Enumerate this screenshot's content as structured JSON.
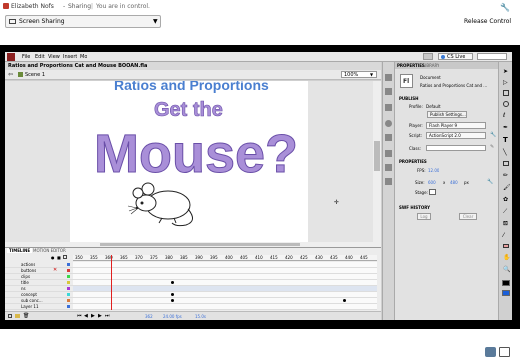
{
  "share_header": {
    "presenter": "Elizabeth Nofs",
    "app": "Sharing",
    "status": "You are in control.",
    "mode": "Screen Sharing",
    "release": "Release Control"
  },
  "menu": {
    "items": [
      "File",
      "Edit",
      "View",
      "Insert",
      "Mo"
    ],
    "cs_live": "CS Live"
  },
  "document": {
    "tab_title": "Ratios and Proportions Cat and Mouse BOOAN.fla",
    "scene": "Scene 1",
    "zoom": "100%"
  },
  "stage": {
    "title": "Ratios and Proportions",
    "get_the": "Get the",
    "mouse": "Mouse?"
  },
  "timeline": {
    "tabs": [
      "TIMELINE",
      "MOTION EDITOR"
    ],
    "frames": [
      "350",
      "355",
      "360",
      "365",
      "370",
      "375",
      "380",
      "385",
      "390",
      "395",
      "400",
      "405",
      "410",
      "415",
      "420",
      "425",
      "430",
      "435",
      "440",
      "445"
    ],
    "layers": [
      "actions",
      "buttons",
      "clips",
      "title",
      "ns",
      "concept",
      "sub conc...",
      "Layer 11"
    ],
    "footer_values": [
      "362",
      "24.00 fps",
      "15.0s"
    ]
  },
  "properties": {
    "tabs": [
      "PROPERTIES",
      "LIBRARY"
    ],
    "doc_label": "Document",
    "doc_icon": "Fl",
    "doc_name": "Ratios and Proportions Cat and ...",
    "publish_header": "PUBLISH",
    "profile_label": "Profile:",
    "profile_value": "Default",
    "publish_settings": "Publish Settings...",
    "player_label": "Player:",
    "player_value": "Flash Player 9",
    "script_label": "Script:",
    "script_value": "ActionScript 2.0",
    "class_label": "Class:",
    "properties_header": "PROPERTIES",
    "fps_label": "FPS:",
    "fps_value": "12.00",
    "size_label": "Size:",
    "size_w": "600",
    "size_x": "x",
    "size_h": "480",
    "size_unit": "px",
    "edit_label": "Edit...",
    "stage_label": "Stage:",
    "swf_header": "SWF HISTORY",
    "log_button": "Log",
    "clear_button": "Clear"
  }
}
